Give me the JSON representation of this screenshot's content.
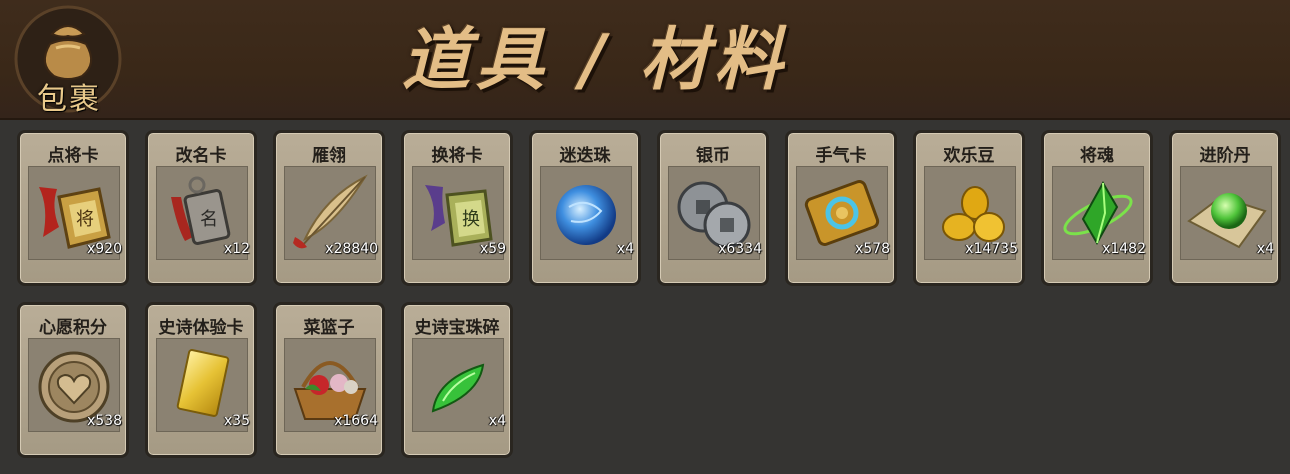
{
  "header": {
    "bag_label": "包裹",
    "title": "道具 / 材料"
  },
  "items": [
    {
      "name": "点将卡",
      "count": "x920",
      "icon": "general-token-icon"
    },
    {
      "name": "改名卡",
      "count": "x12",
      "icon": "rename-token-icon"
    },
    {
      "name": "雁翎",
      "count": "x28840",
      "icon": "feather-icon"
    },
    {
      "name": "换将卡",
      "count": "x59",
      "icon": "swap-token-icon"
    },
    {
      "name": "迷迭珠",
      "count": "x4",
      "icon": "blue-orb-icon"
    },
    {
      "name": "银币",
      "count": "x6334",
      "icon": "silver-coins-icon"
    },
    {
      "name": "手气卡",
      "count": "x578",
      "icon": "luck-card-icon"
    },
    {
      "name": "欢乐豆",
      "count": "x14735",
      "icon": "gold-beans-icon"
    },
    {
      "name": "将魂",
      "count": "x1482",
      "icon": "green-crystal-icon"
    },
    {
      "name": "进阶丹",
      "count": "x4",
      "icon": "green-pill-icon"
    },
    {
      "name": "心愿积分",
      "count": "x538",
      "icon": "heart-coin-icon"
    },
    {
      "name": "史诗体验卡",
      "count": "x35",
      "icon": "gold-card-icon"
    },
    {
      "name": "菜篮子",
      "count": "x1664",
      "icon": "basket-icon"
    },
    {
      "name": "史诗宝珠碎",
      "count": "x4",
      "icon": "green-shard-icon"
    }
  ]
}
